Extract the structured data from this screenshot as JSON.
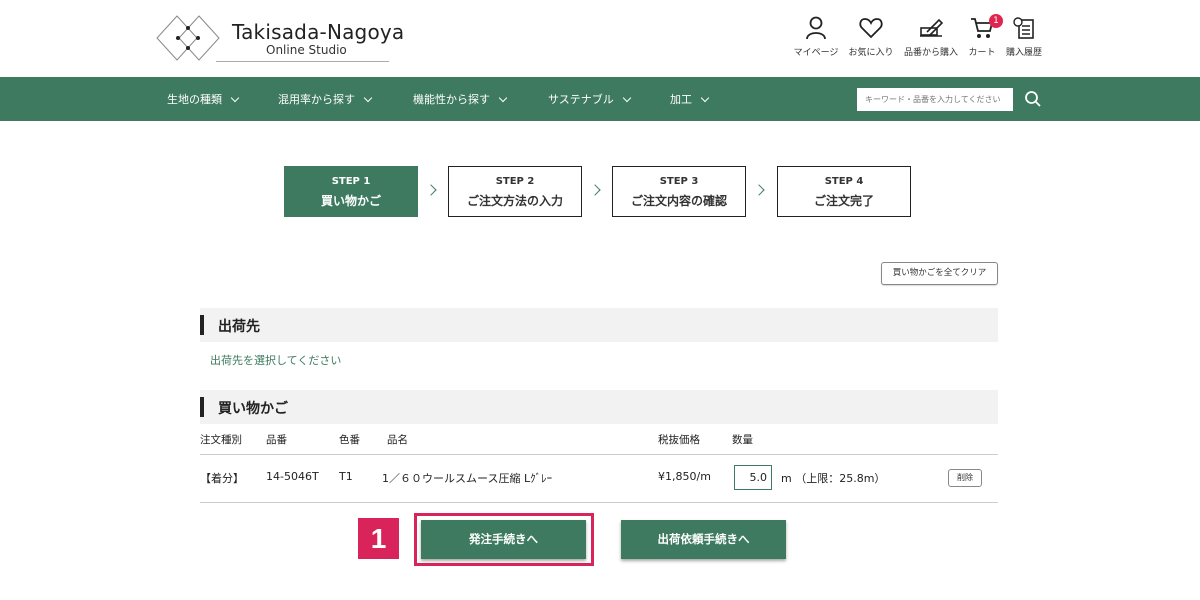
{
  "brand": {
    "title": "Takisada-Nagoya",
    "subtitle": "Online Studio"
  },
  "header_icons": [
    {
      "name": "user-icon",
      "label": "マイページ"
    },
    {
      "name": "heart-icon",
      "label": "お気に入り"
    },
    {
      "name": "pencil-order-icon",
      "label": "品番から購入"
    },
    {
      "name": "cart-icon",
      "label": "カート",
      "badge": "1"
    },
    {
      "name": "history-icon",
      "label": "購入履歴"
    }
  ],
  "nav": {
    "items": [
      "生地の種類",
      "混用率から探す",
      "機能性から探す",
      "サステナブル",
      "加工"
    ],
    "search_placeholder": "キーワード・品番を入力してください"
  },
  "steps": [
    {
      "num": "STEP 1",
      "title": "買い物かご",
      "active": true
    },
    {
      "num": "STEP 2",
      "title": "ご注文方法の入力",
      "active": false
    },
    {
      "num": "STEP 3",
      "title": "ご注文内容の確認",
      "active": false
    },
    {
      "num": "STEP 4",
      "title": "ご注文完了",
      "active": false
    }
  ],
  "clear_button": "買い物かごを全てクリア",
  "shipping": {
    "heading": "出荷先",
    "link": "出荷先を選択してください"
  },
  "cart": {
    "heading": "買い物かご",
    "columns": [
      "注文種別",
      "品番",
      "色番",
      "品名",
      "税抜価格",
      "数量"
    ],
    "row": {
      "type": "【着分】",
      "part_no": "14-5046T",
      "color_no": "T1",
      "name": "1／６０ウールスムース圧縮 Lｸﾞﾚｰ",
      "price": "¥1,850/m",
      "quantity": "5.0",
      "unit_limit": "m （上限：25.8m）",
      "delete": "削除"
    }
  },
  "annotation_number": "1",
  "buttons": {
    "order": "発注手続きへ",
    "ship_request": "出荷依頼手続きへ"
  },
  "colors": {
    "accent": "#3d7a5f",
    "highlight": "#d8245a",
    "badge": "#e0264f"
  }
}
